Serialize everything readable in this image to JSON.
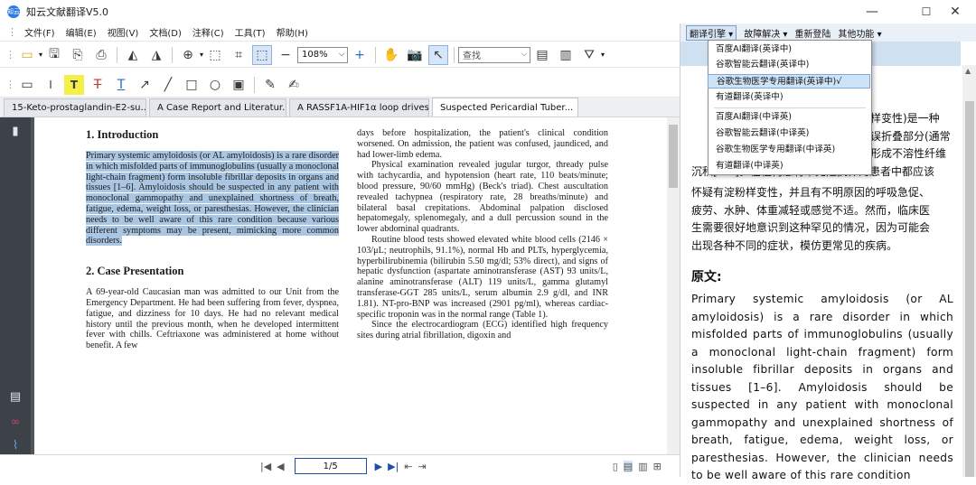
{
  "app": {
    "title": "知云文献翻译V5.0",
    "logo": "知云"
  },
  "window": {
    "minimize": "—",
    "maximize": "☐",
    "close": "✕"
  },
  "menu": [
    "文件(F)",
    "编辑(E)",
    "视图(V)",
    "文档(D)",
    "注释(C)",
    "工具(T)",
    "帮助(H)"
  ],
  "toolbar": {
    "zoom": "108%",
    "search_placeholder": "查找"
  },
  "tabs": [
    {
      "label": "15-Keto-prostaglandin-E2-su..."
    },
    {
      "label": "A Case Report and Literatur..."
    },
    {
      "label": "A RASSF1A-HIF1α loop drives..."
    },
    {
      "label": "Suspected Pericardial Tuber...",
      "close": "✕"
    }
  ],
  "doc": {
    "h1": "1. Introduction",
    "intro": "Primary systemic amyloidosis (or AL amyloidosis) is a rare disorder in which misfolded parts of immunoglobulins (usually a monoclonal light-chain fragment) form insoluble fibrillar deposits in organs and tissues [1–6]. Amyloidosis should be suspected in any patient with monoclonal gammopathy and unexplained shortness of breath, fatigue, edema, weight loss, or paresthesias. However, the clinician needs to be well aware of this rare condition because various different symptoms may be present, mimicking more common disorders.",
    "h2": "2. Case Presentation",
    "case": "A 69-year-old Caucasian man was admitted to our Unit from the Emergency Department. He had been suffering from fever, dyspnea, fatigue, and dizziness for 10 days. He had no relevant medical history until the previous month, when he developed intermittent fever with chills. Ceftriaxone was administered at home without benefit. A few",
    "right1": "days before hospitalization, the patient's clinical condition worsened. On admission, the patient was confused, jaundiced, and had lower-limb edema.",
    "right2": "Physical examination revealed jugular turgor, thready pulse with tachycardia, and hypotension (heart rate, 110 beats/minute; blood pressure, 90/60 mmHg) (Beck's triad). Chest auscultation revealed tachypnea (respiratory rate, 28 breaths/minute) and bilateral basal crepitations. Abdominal palpation disclosed hepatomegaly, splenomegaly, and a dull percussion sound in the lower abdominal quadrants.",
    "right3": "Routine blood tests showed elevated white blood cells (2146 × 103/μL; neutrophils, 91.1%), normal Hb and PLTs, hyperglycemia, hyperbilirubinemia (bilirubin 5.50 mg/dl; 53% direct), and signs of hepatic dysfunction (aspartate aminotransferase (AST) 93 units/L, alanine aminotransferase (ALT) 119 units/L, gamma glutamyl transferase-GGT 285 units/L, serum albumin 2.9 g/dl, and INR 1.81). NT-pro-BNP was increased (2901 pg/ml), whereas cardiac-specific troponin was in the normal range (Table 1).",
    "right4": "Since the electrocardiogram (ECG) identified high frequency sites during atrial fibrillation, digoxin and"
  },
  "nav": {
    "page": "1/5"
  },
  "right_panel": {
    "menu": {
      "engine": "翻译引擎 ▾",
      "troubleshoot": "故障解决 ▾",
      "relogin": "重新登陆",
      "other": "其他功能 ▾"
    },
    "dropdown": [
      "百度AI翻译(英译中)",
      "谷歌智能云翻译(英译中)",
      "谷歌生物医学专用翻译(英译中)√",
      "有道翻译(英译中)",
      "百度AI翻译(中译英)",
      "谷歌智能云翻译(中译英)",
      "谷歌生物医学专用翻译(中译英)",
      "有道翻译(中译英)"
    ],
    "zh_partial_1": "样变性)是一种",
    "zh_partial_2": "误折叠部分(通常",
    "zh_partial_3": "形成不溶性纤维",
    "zh_partial_4": "沉积[1-6]。在任何患有单克隆抗体的患者中都应该",
    "zh_lines": [
      "怀疑有淀粉样变性，并且有不明原因的呼吸急促、",
      "疲劳、水肿、体重减轻或感觉不适。然而，临床医",
      "生需要很好地意识到这种罕见的情况，因为可能会",
      "出现各种不同的症状，模仿更常见的疾病。"
    ],
    "orig_heading": "原文:",
    "orig_text": "Primary systemic amyloidosis (or AL amyloidosis) is a rare disorder in which misfolded parts of immunoglobulins (usually a monoclonal light-chain fragment) form insoluble fibrillar deposits in organs and tissues [1–6]. Amyloidosis should be suspected in any patient with monoclonal gammopathy and unexplained shortness of breath, fatigue, edema, weight loss, or paresthesias. However, the clinician needs to be well aware of this rare condition"
  }
}
